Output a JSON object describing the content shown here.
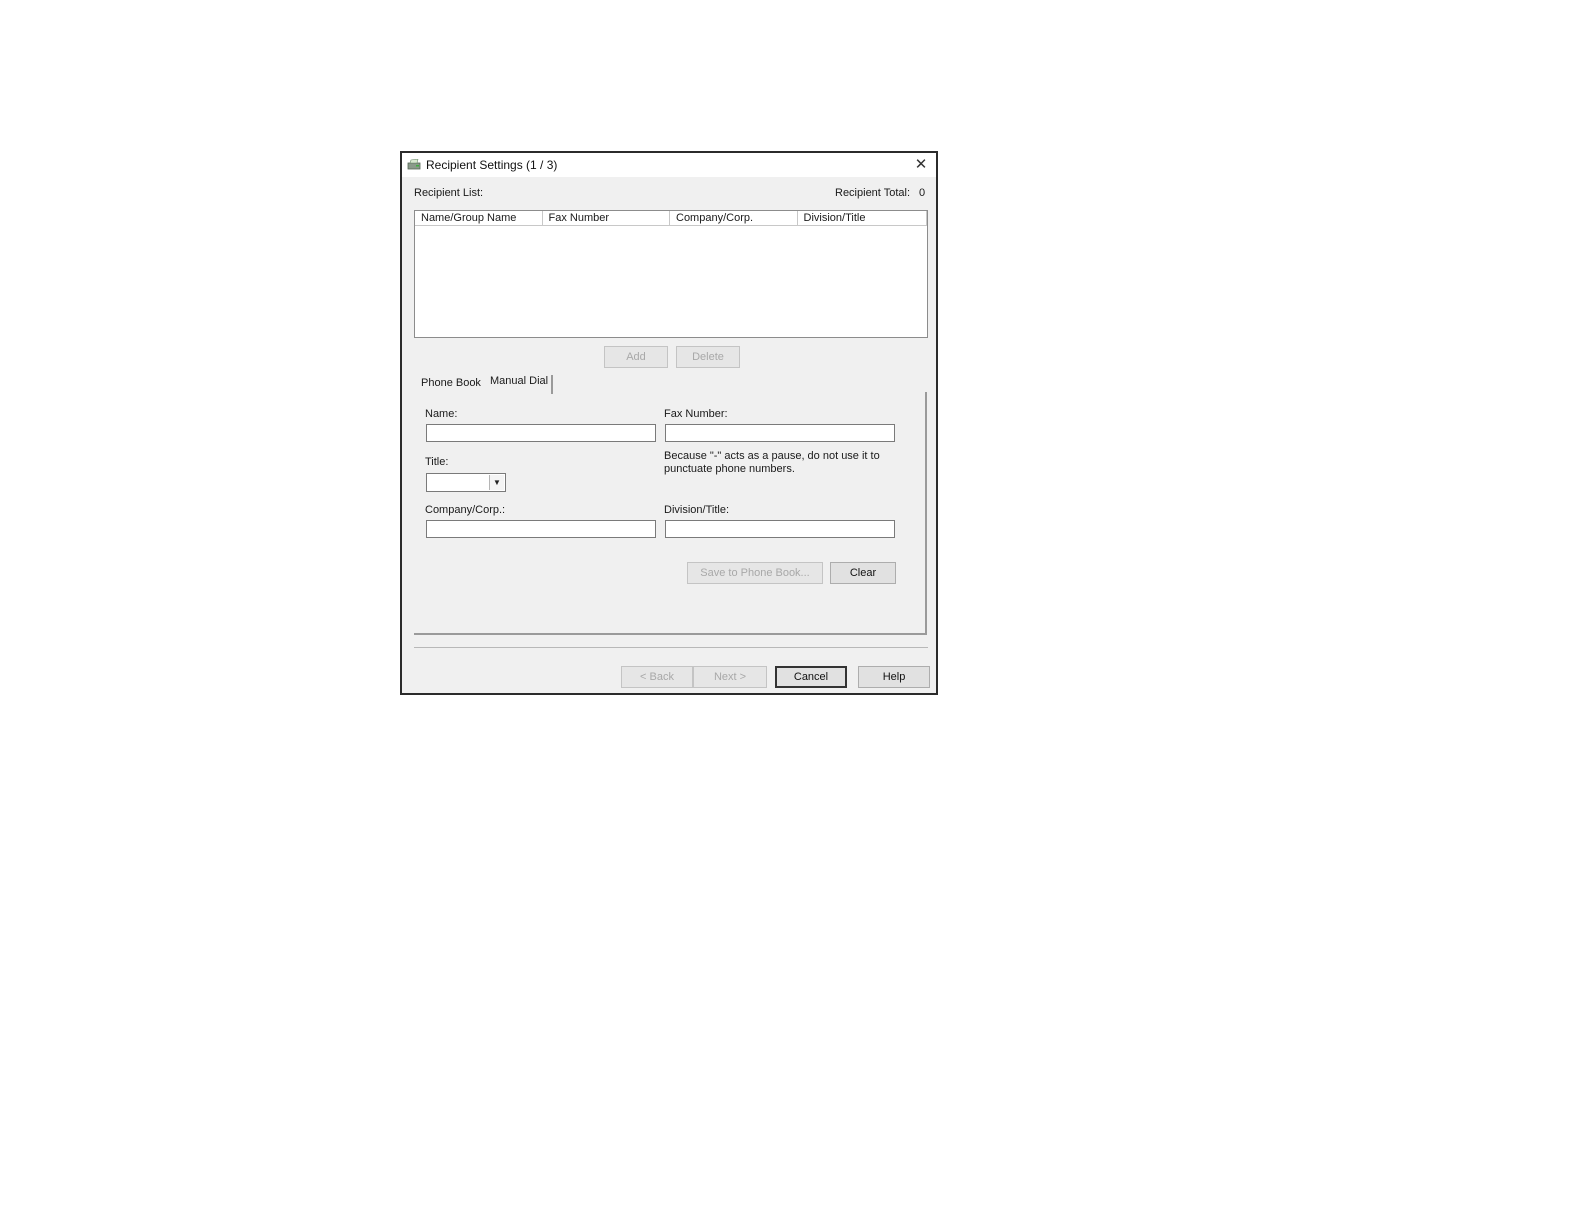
{
  "window": {
    "title": "Recipient Settings (1 / 3)",
    "close_glyph": "✕"
  },
  "recipient_list": {
    "label": "Recipient List:",
    "total_label": "Recipient Total:",
    "total_value": "0",
    "columns": [
      "Name/Group Name",
      "Fax Number",
      "Company/Corp.",
      "Division/Title"
    ],
    "rows": []
  },
  "list_buttons": {
    "add": "Add",
    "delete": "Delete"
  },
  "tabs": [
    {
      "label": "Phone Book",
      "selected": false
    },
    {
      "label": "Manual Dial",
      "selected": true
    }
  ],
  "form": {
    "name_label": "Name:",
    "name_value": "",
    "fax_label": "Fax Number:",
    "fax_value": "",
    "fax_note": "Because \"-\" acts as a pause, do not use it to punctuate phone numbers.",
    "title_label": "Title:",
    "title_value": "",
    "company_label": "Company/Corp.:",
    "company_value": "",
    "division_label": "Division/Title:",
    "division_value": ""
  },
  "form_buttons": {
    "save": "Save to Phone Book...",
    "clear": "Clear"
  },
  "footer_buttons": {
    "back": "< Back",
    "next": "Next >",
    "cancel": "Cancel",
    "help": "Help"
  },
  "icons": {
    "app": "fax-printer-icon",
    "close": "close-icon",
    "dropdown": "chevron-down-icon"
  },
  "colors": {
    "dialog_bg": "#f0f0f0",
    "titlebar_bg": "#ffffff",
    "border": "#2b2b2b",
    "disabled_text": "#a8a8a8"
  }
}
